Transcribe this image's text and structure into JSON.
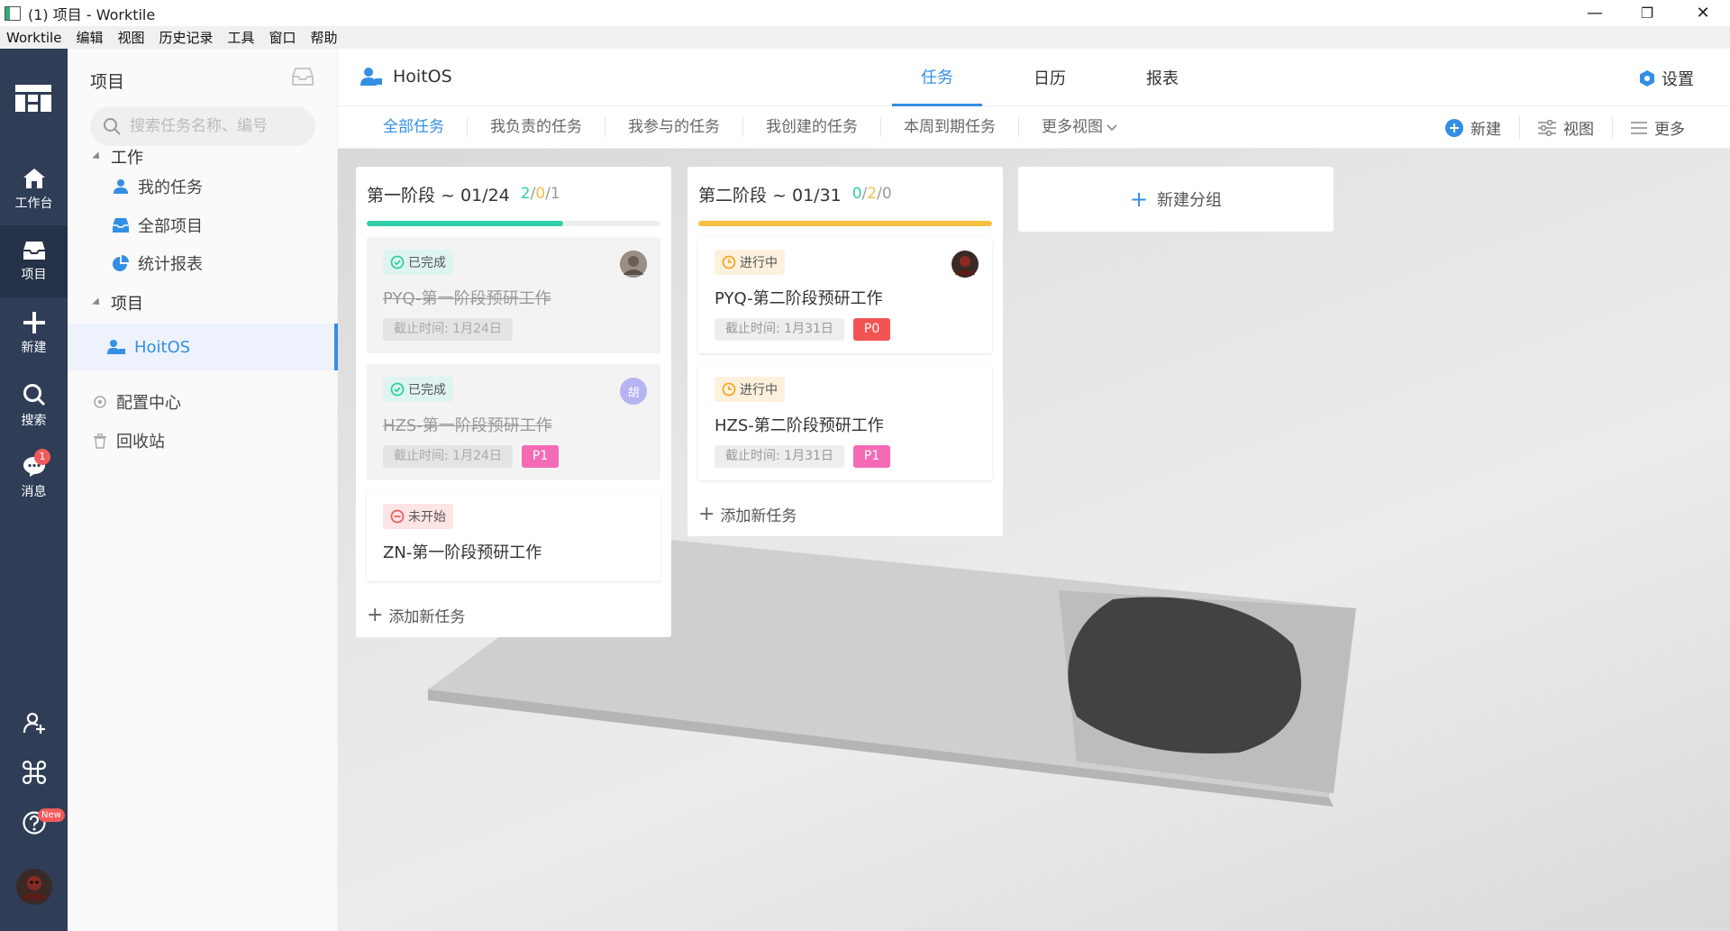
{
  "window": {
    "title": "(1) 项目 - Worktile",
    "minimize": "—",
    "restore": "❐",
    "close": "✕"
  },
  "menubar": [
    "Worktile",
    "编辑",
    "视图",
    "历史记录",
    "工具",
    "窗口",
    "帮助"
  ],
  "rail": {
    "items": [
      {
        "label": "工作台",
        "icon": "home-icon"
      },
      {
        "label": "项目",
        "icon": "inbox-icon"
      },
      {
        "label": "新建",
        "icon": "plus-icon"
      },
      {
        "label": "搜索",
        "icon": "search-icon"
      },
      {
        "label": "消息",
        "icon": "chat-icon",
        "badge": "1"
      }
    ],
    "help_badge": "New"
  },
  "sidebar": {
    "title": "项目",
    "search_placeholder": "搜索任务名称、编号",
    "group_work": "工作",
    "work_items": [
      {
        "label": "我的任务",
        "icon": "user-icon"
      },
      {
        "label": "全部项目",
        "icon": "inbox-icon"
      },
      {
        "label": "统计报表",
        "icon": "pie-chart-icon"
      }
    ],
    "group_projects": "项目",
    "project_items": [
      {
        "label": "HoitOS",
        "icon": "team-icon"
      }
    ],
    "config": "配置中心",
    "trash": "回收站"
  },
  "header": {
    "project_name": "HoitOS",
    "tabs": [
      "任务",
      "日历",
      "报表"
    ],
    "settings": "设置"
  },
  "views": {
    "tabs": [
      "全部任务",
      "我负责的任务",
      "我参与的任务",
      "我创建的任务",
      "本周到期任务",
      "更多视图"
    ],
    "tools": [
      "新建",
      "视图",
      "更多"
    ]
  },
  "colors": {
    "accent": "#348fe4",
    "rail": "#2f3d56",
    "done": "#2ecfa8",
    "doing": "#f5c042",
    "todo": "#ef5d5d",
    "p0": "#f25353",
    "p1": "#f46ab5"
  },
  "board": {
    "columns": [
      {
        "title": "第一阶段 ~ 01/24",
        "count_done": "2",
        "count_doing": "0",
        "count_todo": "1",
        "slash": "/",
        "progress": 0.67,
        "progress_color": "#2ecfa8",
        "add_task": "添加新任务",
        "cards": [
          {
            "status": "已完成",
            "title": "PYQ-第一阶段预研工作",
            "due": "截止时间: 1月24日",
            "priority": "",
            "avatar_text": ""
          },
          {
            "status": "已完成",
            "title": "HZS-第一阶段预研工作",
            "due": "截止时间: 1月24日",
            "priority": "P1",
            "avatar_text": "胡"
          },
          {
            "status": "未开始",
            "title": "ZN-第一阶段预研工作",
            "due": "",
            "priority": "",
            "avatar_text": ""
          }
        ]
      },
      {
        "title": "第二阶段 ~ 01/31",
        "count_done": "0",
        "count_doing": "2",
        "count_todo": "0",
        "slash": "/",
        "progress": 1.0,
        "progress_color": "#f5c042",
        "add_task": "添加新任务",
        "cards": [
          {
            "status": "进行中",
            "title": "PYQ-第二阶段预研工作",
            "due": "截止时间: 1月31日",
            "priority": "P0",
            "avatar_text": ""
          },
          {
            "status": "进行中",
            "title": "HZS-第二阶段预研工作",
            "due": "截止时间: 1月31日",
            "priority": "P1",
            "avatar_text": ""
          }
        ]
      }
    ],
    "new_group": "新建分组"
  }
}
